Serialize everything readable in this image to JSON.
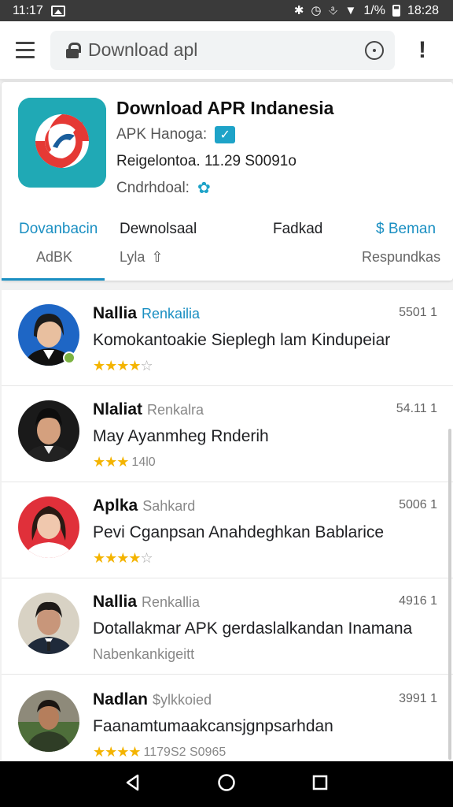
{
  "status_bar": {
    "time_left": "11:17",
    "battery_pct": "1/%",
    "time_right": "18:28"
  },
  "search": {
    "value": "Download apl"
  },
  "app": {
    "title": "Download APR Indanesia",
    "meta1": "APK Hanoga:",
    "meta2": "Reigelontoa. 11.29 S0091o",
    "meta3": "Cndrhdoal:"
  },
  "tabs": [
    {
      "title": "Dovanbacin",
      "sub": "AdBK"
    },
    {
      "title": "Dewnolsaal",
      "sub": "Lyla"
    },
    {
      "title": "Fadkad",
      "sub": ""
    },
    {
      "title": "$ Beman",
      "sub": "Respundkas"
    }
  ],
  "items": [
    {
      "name": "Nallia",
      "handle": "Renkailia",
      "stamp": "5501 1",
      "message": "Komokantoakie Sieplegh lam Kindupeiar",
      "rating_text": ""
    },
    {
      "name": "Nlaliat",
      "handle": "Renkalra",
      "stamp": "54.11 1",
      "message": "May Ayanmheg Rnderih",
      "rating_text": "14l0"
    },
    {
      "name": "Aplka",
      "handle": "Sahkard",
      "stamp": "5006 1",
      "message": "Pevi Cganpsan Anahdeghkan Bablarice",
      "rating_text": ""
    },
    {
      "name": "Nallia",
      "handle": "Renkallia",
      "stamp": "4916 1",
      "message": "Dotallakmar APK gerdaslalkandan Inamana",
      "rating_text": "Nabenkankigeitt"
    },
    {
      "name": "Nadlan",
      "handle": "$ylkkoied",
      "stamp": "3991 1",
      "message": "Faanamtumaakcansjgnpsarhdan",
      "rating_text": "1179S2 S0965"
    }
  ],
  "colors": {
    "accent": "#1a8fc2",
    "star": "#f4b400",
    "app_icon_bg": "#20a9b5"
  }
}
